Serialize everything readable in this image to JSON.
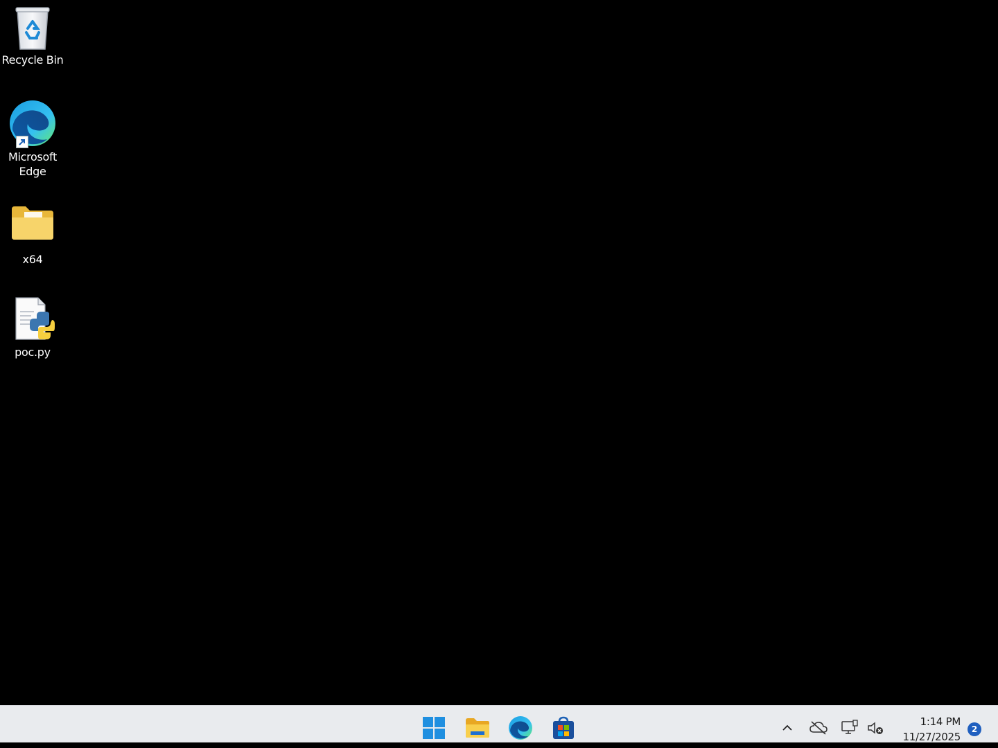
{
  "desktop": {
    "icons": [
      {
        "label": "Recycle Bin",
        "icon": "recycle-bin-icon"
      },
      {
        "label": "Microsoft\nEdge",
        "icon": "edge-icon",
        "shortcut": true
      },
      {
        "label": "x64",
        "icon": "folder-icon"
      },
      {
        "label": "poc.py",
        "icon": "python-file-icon"
      }
    ]
  },
  "taskbar": {
    "apps": [
      {
        "name": "Start",
        "icon": "windows-start-icon"
      },
      {
        "name": "File Explorer",
        "icon": "file-explorer-icon"
      },
      {
        "name": "Microsoft Edge",
        "icon": "edge-icon"
      },
      {
        "name": "Microsoft Store",
        "icon": "store-icon"
      }
    ],
    "tray": {
      "icons": [
        "chevron-up-icon",
        "onedrive-offline-icon",
        "network-icon",
        "sound-muted-icon"
      ],
      "time": "1:14 PM",
      "date": "11/27/2025",
      "notifications": "2"
    },
    "colors": {
      "background": "#e9ebee",
      "accent": "#1f5fbf"
    }
  }
}
